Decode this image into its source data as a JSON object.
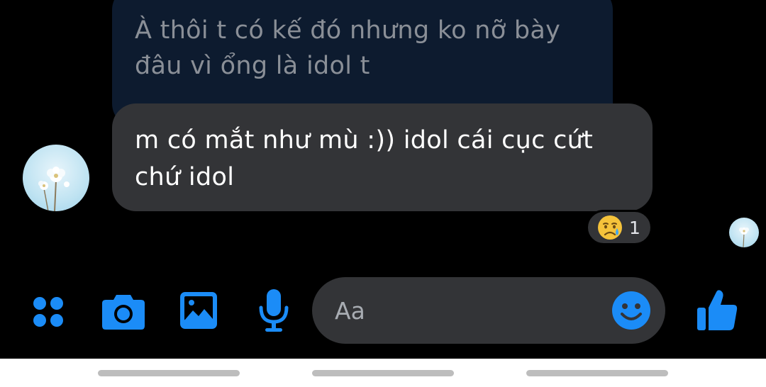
{
  "conversation": {
    "quoted_message": {
      "lines": [
        "À thôi t có kế đó nhưng ko nỡ bày",
        "đâu vì ổng là idol t"
      ]
    },
    "message": {
      "lines": [
        "m có mắt như mù :)) idol cái cục cứt",
        "chứ idol"
      ]
    },
    "reaction": {
      "emoji": "😢",
      "icon": "sad-tear-emoji",
      "count": "1"
    }
  },
  "composer": {
    "placeholder": "Aa",
    "buttons": [
      "menu-dots-icon",
      "camera-icon",
      "gallery-icon",
      "microphone-icon",
      "emoji-icon",
      "thumbs-up-icon"
    ],
    "accent_color": "#1b8cf7"
  },
  "colors": {
    "background": "#000000",
    "quoted_bubble": "#0d1b2f",
    "incoming_bubble": "#333437",
    "accent": "#1b8cf7"
  }
}
